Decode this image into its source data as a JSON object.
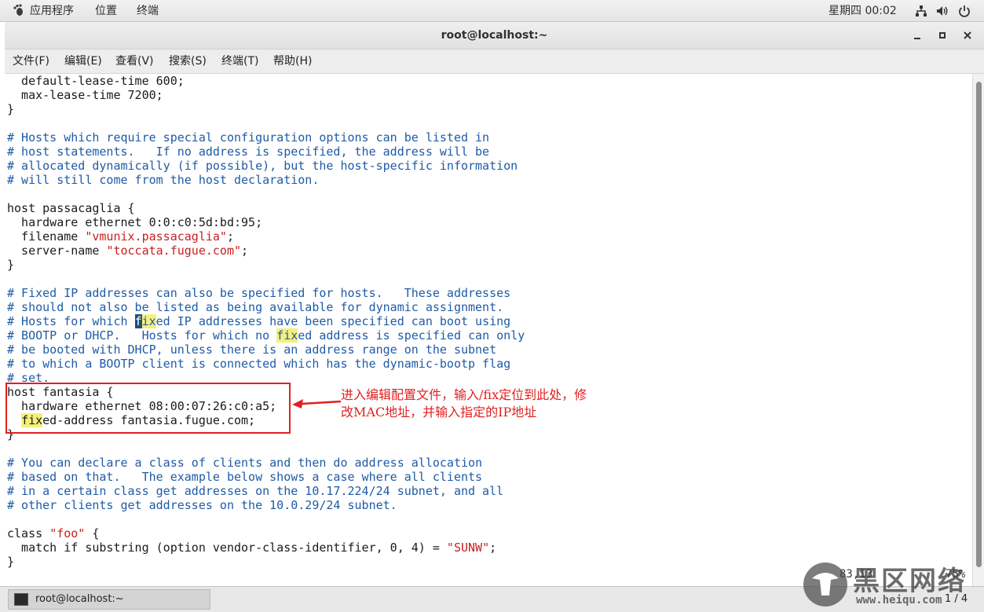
{
  "topbar": {
    "apps": "应用程序",
    "places": "位置",
    "terminal": "终端",
    "clock": "星期四 00:02"
  },
  "window": {
    "title": "root@localhost:~"
  },
  "menubar": {
    "file": "文件(F)",
    "edit": "编辑(E)",
    "view": "查看(V)",
    "search": "搜索(S)",
    "terminal": "终端(T)",
    "help": "帮助(H)"
  },
  "editor": {
    "lines": [
      {
        "parts": [
          {
            "t": "  default-lease-time 600;",
            "k": "n"
          }
        ]
      },
      {
        "parts": [
          {
            "t": "  max-lease-time 7200;",
            "k": "n"
          }
        ]
      },
      {
        "parts": [
          {
            "t": "}",
            "k": "n"
          }
        ]
      },
      {
        "parts": []
      },
      {
        "parts": [
          {
            "t": "# Hosts which require special configuration options can be listed in",
            "k": "c"
          }
        ]
      },
      {
        "parts": [
          {
            "t": "# host statements.   If no address is specified, the address will be",
            "k": "c"
          }
        ]
      },
      {
        "parts": [
          {
            "t": "# allocated dynamically (if possible), but the host-specific information",
            "k": "c"
          }
        ]
      },
      {
        "parts": [
          {
            "t": "# will still come from the host declaration.",
            "k": "c"
          }
        ]
      },
      {
        "parts": []
      },
      {
        "parts": [
          {
            "t": "host passacaglia {",
            "k": "n"
          }
        ]
      },
      {
        "parts": [
          {
            "t": "  hardware ethernet 0:0:c0:5d:bd:95;",
            "k": "n"
          }
        ]
      },
      {
        "parts": [
          {
            "t": "  filename ",
            "k": "n"
          },
          {
            "t": "\"vmunix.passacaglia\"",
            "k": "s"
          },
          {
            "t": ";",
            "k": "n"
          }
        ]
      },
      {
        "parts": [
          {
            "t": "  server-name ",
            "k": "n"
          },
          {
            "t": "\"toccata.fugue.com\"",
            "k": "s"
          },
          {
            "t": ";",
            "k": "n"
          }
        ]
      },
      {
        "parts": [
          {
            "t": "}",
            "k": "n"
          }
        ]
      },
      {
        "parts": []
      },
      {
        "parts": [
          {
            "t": "# Fixed IP addresses can also be specified for hosts.   These addresses",
            "k": "c"
          }
        ]
      },
      {
        "parts": [
          {
            "t": "# should not also be listed as being available for dynamic assignment.",
            "k": "c"
          }
        ]
      },
      {
        "parts": [
          {
            "t": "# Hosts for which ",
            "k": "c"
          },
          {
            "t": "f",
            "k": "cur"
          },
          {
            "t": "ix",
            "k": "hlc"
          },
          {
            "t": "ed IP addresses have been specified can boot using",
            "k": "c"
          }
        ]
      },
      {
        "parts": [
          {
            "t": "# BOOTP or DHCP.   Hosts for which no ",
            "k": "c"
          },
          {
            "t": "fix",
            "k": "hlc"
          },
          {
            "t": "ed address is specified can only",
            "k": "c"
          }
        ]
      },
      {
        "parts": [
          {
            "t": "# be booted with DHCP, unless there is an address range on the subnet",
            "k": "c"
          }
        ]
      },
      {
        "parts": [
          {
            "t": "# to which a BOOTP client is connected which has the dynamic-bootp flag",
            "k": "c"
          }
        ]
      },
      {
        "parts": [
          {
            "t": "# set.",
            "k": "c"
          }
        ]
      },
      {
        "parts": [
          {
            "t": "host fantasia {",
            "k": "n"
          }
        ]
      },
      {
        "parts": [
          {
            "t": "  hardware ethernet 08:00:07:26:c0:a5;",
            "k": "n"
          }
        ]
      },
      {
        "parts": [
          {
            "t": "  ",
            "k": "n"
          },
          {
            "t": "fix",
            "k": "hl"
          },
          {
            "t": "ed-address fantasia.fugue.com;",
            "k": "n"
          }
        ]
      },
      {
        "parts": [
          {
            "t": "}",
            "k": "n"
          }
        ]
      },
      {
        "parts": []
      },
      {
        "parts": [
          {
            "t": "# You can declare a class of clients and then do address allocation",
            "k": "c"
          }
        ]
      },
      {
        "parts": [
          {
            "t": "# based on that.   The example below shows a case where all clients",
            "k": "c"
          }
        ]
      },
      {
        "parts": [
          {
            "t": "# in a certain class get addresses on the 10.17.224/24 subnet, and all",
            "k": "c"
          }
        ]
      },
      {
        "parts": [
          {
            "t": "# other clients get addresses on the 10.0.29/24 subnet.",
            "k": "c"
          }
        ]
      },
      {
        "parts": []
      },
      {
        "parts": [
          {
            "t": "class ",
            "k": "n"
          },
          {
            "t": "\"foo\"",
            "k": "s"
          },
          {
            "t": " {",
            "k": "n"
          }
        ]
      },
      {
        "parts": [
          {
            "t": "  match if substring (option vendor-class-identifier, 0, 4) = ",
            "k": "n"
          },
          {
            "t": "\"SUNW\"",
            "k": "s"
          },
          {
            "t": ";",
            "k": "n"
          }
        ]
      },
      {
        "parts": [
          {
            "t": "}",
            "k": "n"
          }
        ]
      }
    ],
    "status_position": "83,13",
    "status_percent": "75%"
  },
  "annotation": {
    "line1": "进入编辑配置文件，输入/fix定位到此处，修",
    "line2": "改MAC地址，并输入指定的IP地址",
    "color": "#e02020"
  },
  "taskbar": {
    "item": "root@localhost:~",
    "workspace": "1 / 4"
  },
  "watermark": {
    "text": "黑区网络",
    "url": "www.heiqu.com"
  },
  "colors": {
    "comment": "#1f5ba6",
    "string": "#c81e1e",
    "highlight": "#f5f07a"
  }
}
